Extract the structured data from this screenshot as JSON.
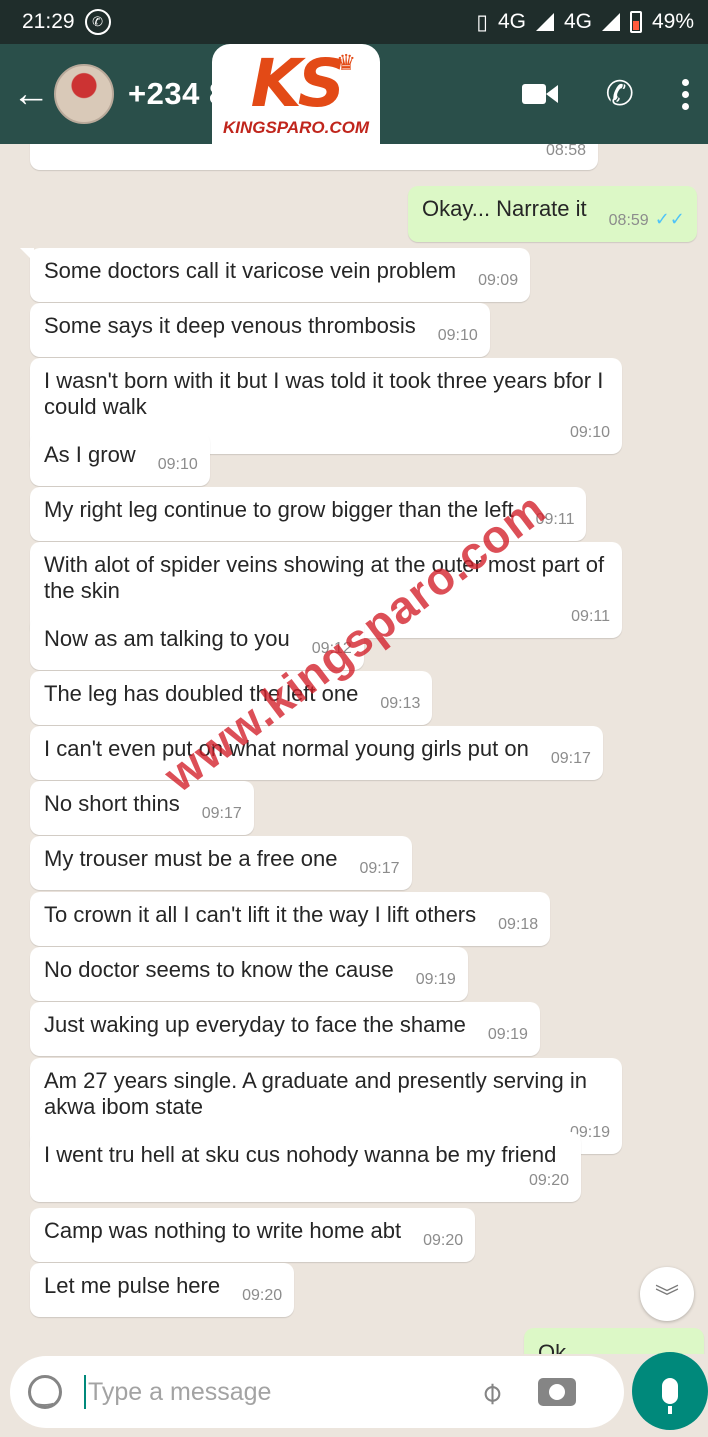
{
  "status_bar": {
    "time": "21:29",
    "network_1": "4G",
    "network_2": "4G",
    "battery": "49%"
  },
  "header": {
    "contact": "+234 8",
    "icons": [
      "back-arrow-icon",
      "video-call-icon",
      "phone-icon",
      "menu-icon"
    ]
  },
  "logo": {
    "mark": "KS",
    "site": "KINGSPARO.COM"
  },
  "watermark": "www.kingsparo.com",
  "messages": [
    {
      "dir": "in",
      "text": "",
      "time": "08:58"
    },
    {
      "dir": "out",
      "text": "Okay... Narrate it",
      "time": "08:59",
      "ticks": "✓✓"
    },
    {
      "dir": "in",
      "text": "Some doctors call it varicose vein problem",
      "time": "09:09"
    },
    {
      "dir": "in",
      "text": "Some says it deep venous  thrombosis",
      "time": "09:10"
    },
    {
      "dir": "in",
      "text": "I wasn't born with it but I was told it took three years bfor I could walk",
      "time": "09:10"
    },
    {
      "dir": "in",
      "text": "As I grow",
      "time": "09:10"
    },
    {
      "dir": "in",
      "text": "My right leg continue to grow bigger than the left",
      "time": "09:11"
    },
    {
      "dir": "in",
      "text": "With alot of spider veins showing at the outer most part of the skin",
      "time": "09:11"
    },
    {
      "dir": "in",
      "text": "Now as am talking to you",
      "time": "09:12"
    },
    {
      "dir": "in",
      "text": "The leg has doubled the left one",
      "time": "09:13"
    },
    {
      "dir": "in",
      "text": "I can't even put on what normal young girls put on",
      "time": "09:17"
    },
    {
      "dir": "in",
      "text": "No short thins",
      "time": "09:17"
    },
    {
      "dir": "in",
      "text": "My trouser must be a free one",
      "time": "09:17"
    },
    {
      "dir": "in",
      "text": "To crown it all I can't lift it the way I lift others",
      "time": "09:18"
    },
    {
      "dir": "in",
      "text": "No doctor seems to know the cause",
      "time": "09:19"
    },
    {
      "dir": "in",
      "text": "Just waking up everyday to face the shame",
      "time": "09:19"
    },
    {
      "dir": "in",
      "text": "Am 27 years single. A graduate and presently serving in akwa ibom state",
      "time": "09:19"
    },
    {
      "dir": "in",
      "text": "I went tru hell at sku cus nohody wanna be my friend",
      "time": "09:20"
    },
    {
      "dir": "in",
      "text": "Camp was nothing to write home abt",
      "time": "09:20"
    },
    {
      "dir": "in",
      "text": "Let me pulse here",
      "time": "09:20"
    },
    {
      "dir": "out",
      "text": "Ok",
      "time": ""
    }
  ],
  "composer": {
    "placeholder": "Type a message"
  },
  "colors": {
    "header": "#2a4f4a",
    "outgoing_bubble": "#dcf8c6",
    "accent": "#00897b"
  }
}
